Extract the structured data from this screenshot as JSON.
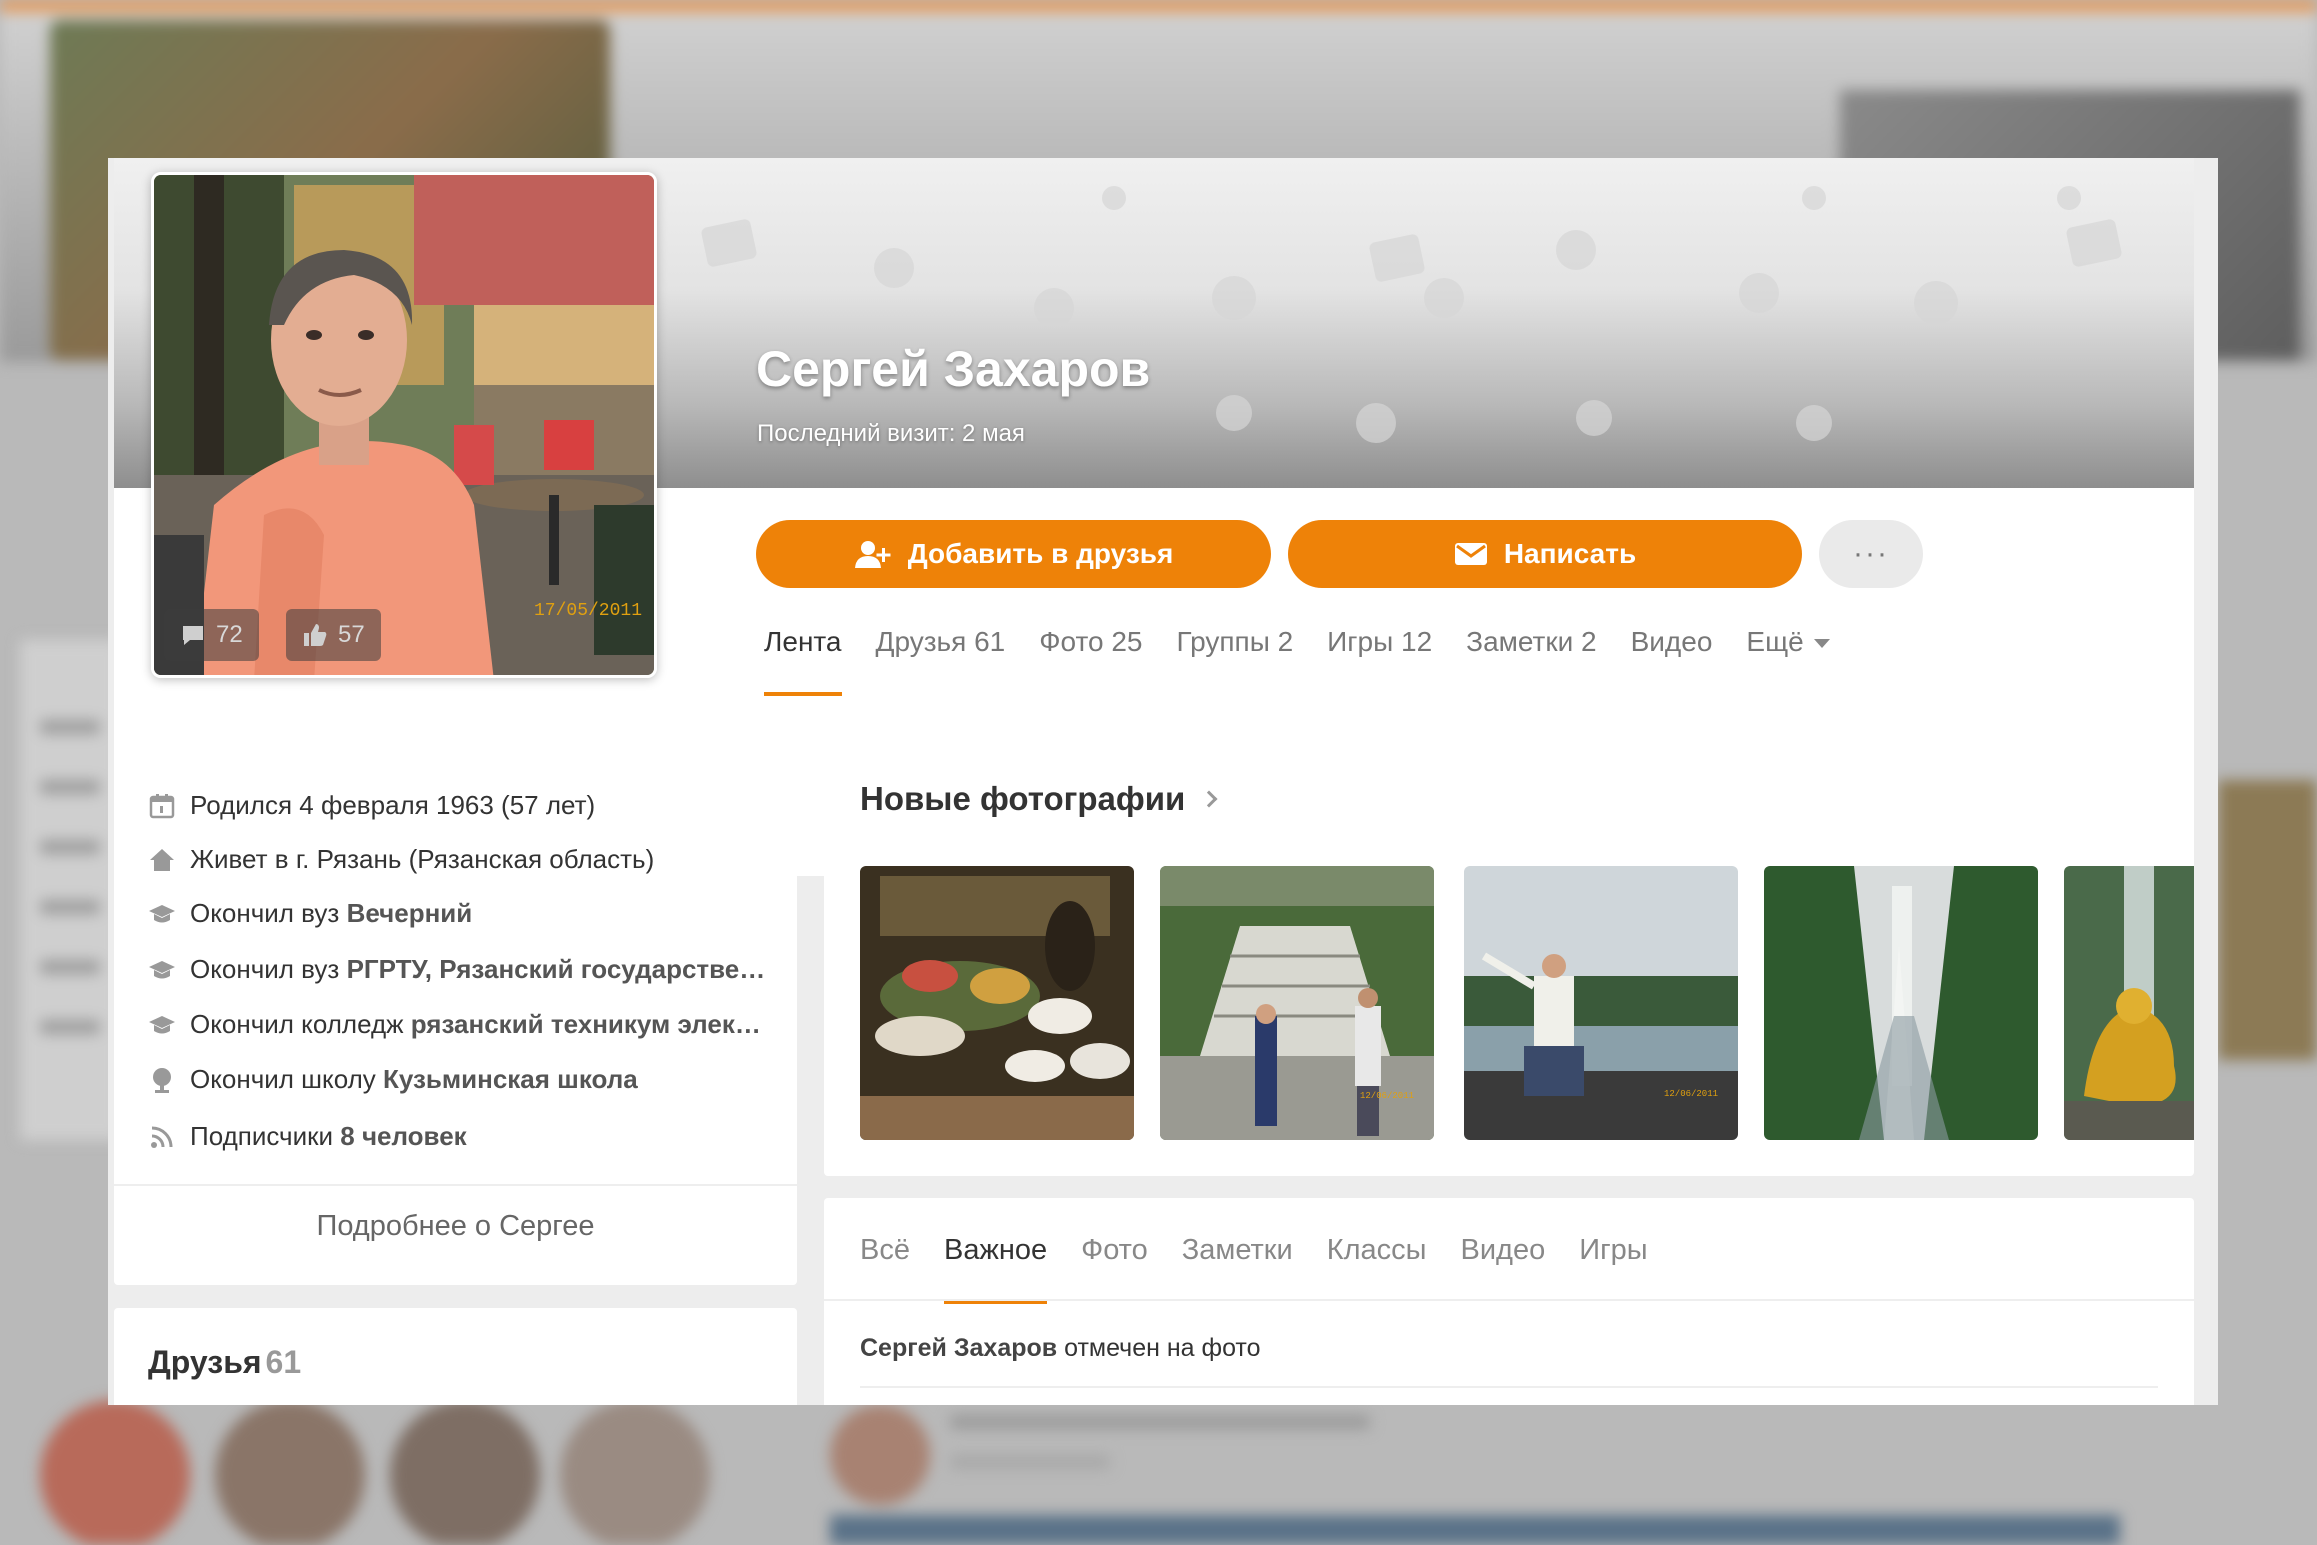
{
  "profile": {
    "name": "Сергей Захаров",
    "last_visit": "Последний визит: 2 мая",
    "avatar_stats": {
      "comments": "72",
      "likes": "57"
    },
    "photo_date": "17/05/2011"
  },
  "actions": {
    "add_friend": "Добавить в друзья",
    "message": "Написать",
    "more": "···"
  },
  "profile_nav": [
    {
      "label": "Лента",
      "count": "",
      "active": true
    },
    {
      "label": "Друзья",
      "count": "61"
    },
    {
      "label": "Фото",
      "count": "25"
    },
    {
      "label": "Группы",
      "count": "2"
    },
    {
      "label": "Игры",
      "count": "12"
    },
    {
      "label": "Заметки",
      "count": "2"
    },
    {
      "label": "Видео",
      "count": ""
    },
    {
      "label": "Ещё",
      "count": ""
    }
  ],
  "info": {
    "born": "Родился 4 февраля 1963 (57 лет)",
    "lives": "Живет в г. Рязань (Рязанская область)",
    "edu1_prefix": "Окончил вуз",
    "edu1_name": "Вечерний",
    "edu2_prefix": "Окончил вуз",
    "edu2_name": "РГРТУ, Рязанский государстве…",
    "edu3_prefix": "Окончил колледж",
    "edu3_name": "рязанский техникум элек…",
    "school_prefix": "Окончил школу",
    "school_name": "Кузьминская школа",
    "subscribers_prefix": "Подписчики",
    "subscribers_value": "8 человек",
    "more_link": "Подробнее о Сергее"
  },
  "friends": {
    "title": "Друзья",
    "count": "61"
  },
  "photos": {
    "title": "Новые фотографии",
    "thumb_dates": [
      "",
      "12/06/2011",
      "12/06/2011",
      "",
      ""
    ]
  },
  "feed": {
    "tabs": [
      {
        "label": "Всё"
      },
      {
        "label": "Важное",
        "active": true
      },
      {
        "label": "Фото"
      },
      {
        "label": "Заметки"
      },
      {
        "label": "Классы"
      },
      {
        "label": "Видео"
      },
      {
        "label": "Игры"
      }
    ],
    "entry_author": "Сергей Захаров",
    "entry_text": " отмечен на фото"
  },
  "colors": {
    "accent": "#ee8208",
    "panel": "#ffffff",
    "page": "#ededed"
  }
}
